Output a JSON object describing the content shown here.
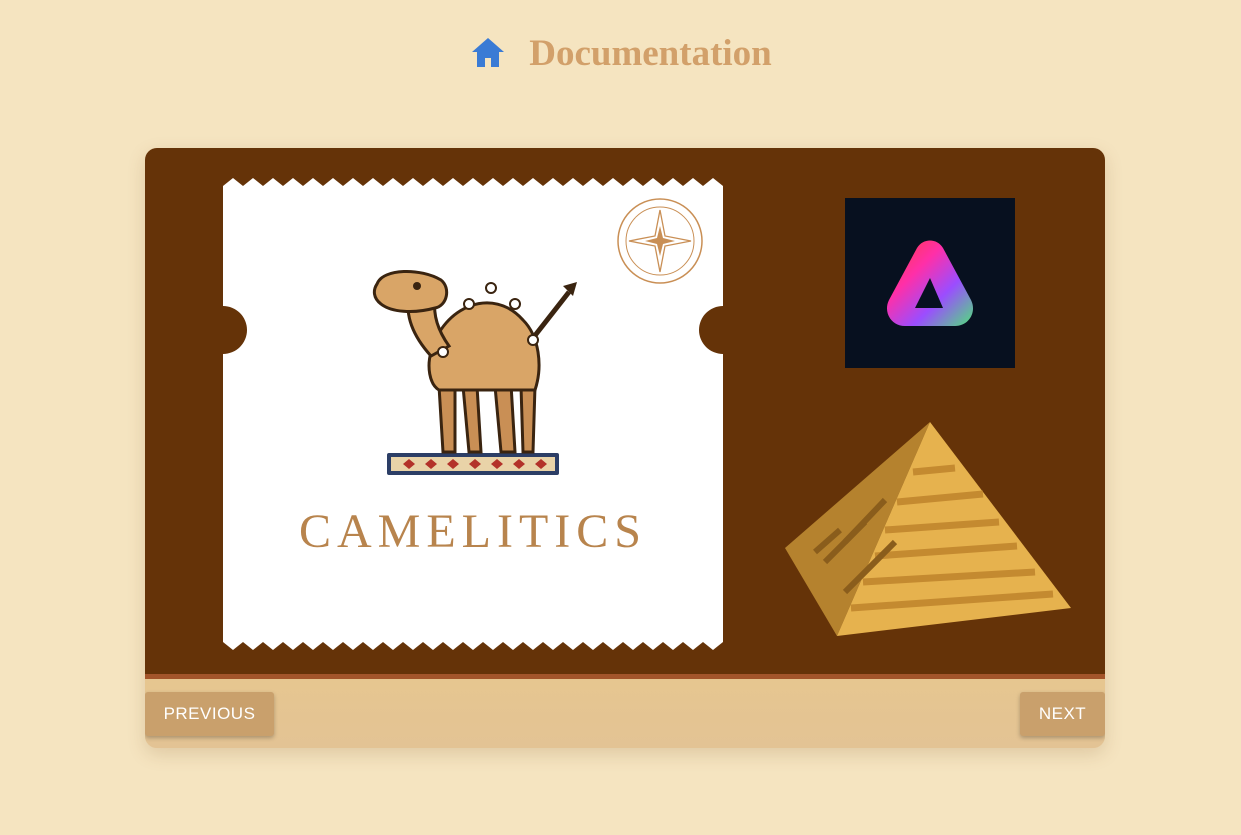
{
  "header": {
    "title": "Documentation",
    "home_icon": "home-icon",
    "home_icon_color": "#3a7bd5"
  },
  "slide": {
    "logo_text": "CAMELITICS",
    "logo_icon": "camel-on-rug-icon",
    "compass_icon": "compass-rose-icon",
    "app_icon": "adobe-express-icon",
    "decoration_icon": "pyramid-icon",
    "background_color": "#653308"
  },
  "nav": {
    "previous_label": "PREVIOUS",
    "next_label": "NEXT",
    "button_color": "#c9a06c"
  }
}
